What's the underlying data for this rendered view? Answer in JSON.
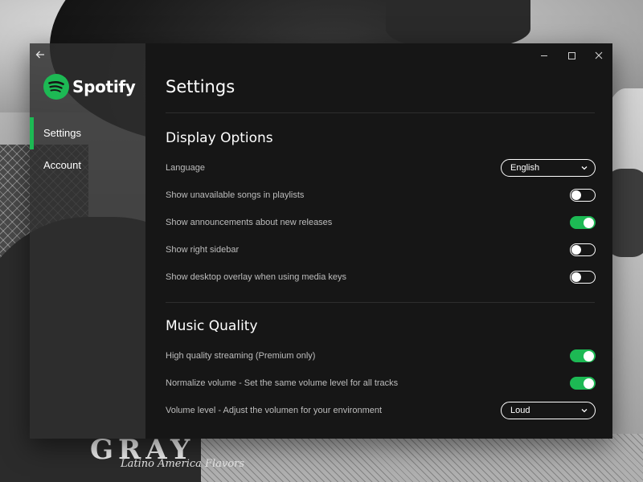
{
  "app": {
    "name": "Spotify",
    "accent_color": "#1db954"
  },
  "nav": {
    "items": [
      {
        "label": "Settings",
        "active": true
      },
      {
        "label": "Account",
        "active": false
      }
    ]
  },
  "page": {
    "title": "Settings"
  },
  "display_options": {
    "title": "Display Options",
    "language": {
      "label": "Language",
      "selected": "English"
    },
    "toggles": [
      {
        "label": "Show unavailable songs in playlists",
        "on": false
      },
      {
        "label": "Show announcements about new releases",
        "on": true
      },
      {
        "label": "Show right sidebar",
        "on": false
      },
      {
        "label": "Show desktop overlay when using media keys",
        "on": false
      }
    ]
  },
  "music_quality": {
    "title": "Music Quality",
    "toggles": [
      {
        "label": "High quality streaming (Premium only)",
        "on": true
      },
      {
        "label": "Normalize volume - Set the same volume level for all tracks",
        "on": true
      }
    ],
    "volume_level": {
      "label": "Volume level - Adjust the volumen for your environment",
      "selected": "Loud"
    }
  },
  "background": {
    "shirt_text": "GRAY",
    "shirt_script": "Latino America Flavors"
  }
}
